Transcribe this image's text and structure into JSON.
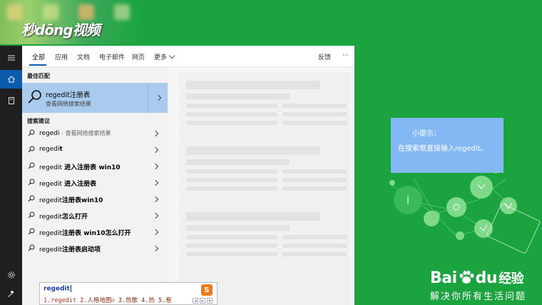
{
  "watermark": {
    "text": "秒dōng视频"
  },
  "tabs": [
    {
      "label": "全部"
    },
    {
      "label": "应用"
    },
    {
      "label": "文档"
    },
    {
      "label": "电子邮件"
    },
    {
      "label": "网页"
    },
    {
      "label": "更多"
    }
  ],
  "tabs_right": {
    "feedback": "反馈",
    "more": "···"
  },
  "best_match": {
    "section": "最佳匹配",
    "title": "regedit注册表",
    "subtitle": "查看网络搜索结果"
  },
  "suggestions": {
    "section": "搜索建议",
    "items": [
      {
        "prefix": "regedi",
        "bold": "",
        "muted": " - 查看网络搜索结果"
      },
      {
        "prefix": "regedi",
        "bold": "t",
        "muted": ""
      },
      {
        "prefix": "regedit",
        "bold": " 进入注册表 win10",
        "muted": ""
      },
      {
        "prefix": "regedit",
        "bold": " 进入注册表",
        "muted": ""
      },
      {
        "prefix": "regedit",
        "bold": "注册表win10",
        "muted": ""
      },
      {
        "prefix": "regedit",
        "bold": "怎么打开",
        "muted": ""
      },
      {
        "prefix": "regedit",
        "bold": "注册表 win10怎么打开",
        "muted": ""
      },
      {
        "prefix": "regedit",
        "bold": "注册表启动项",
        "muted": ""
      }
    ]
  },
  "ime": {
    "input": "regedit",
    "candidates": [
      "1.regedit",
      "2.人格地图",
      "3.热歌",
      "4.热",
      "5.惹"
    ]
  },
  "tip": {
    "title": "小提示：",
    "body": "在搜索框直接输入regedit。"
  },
  "baidu": {
    "logo": "Bai",
    "logo2": "du",
    "jingyan": "经验",
    "slogan": "解决你所有生活问题"
  },
  "colors": {
    "background": "#1aa33f",
    "accent": "#0b5cad",
    "selected": "#a9cbed",
    "tip": "#84b8f5"
  }
}
